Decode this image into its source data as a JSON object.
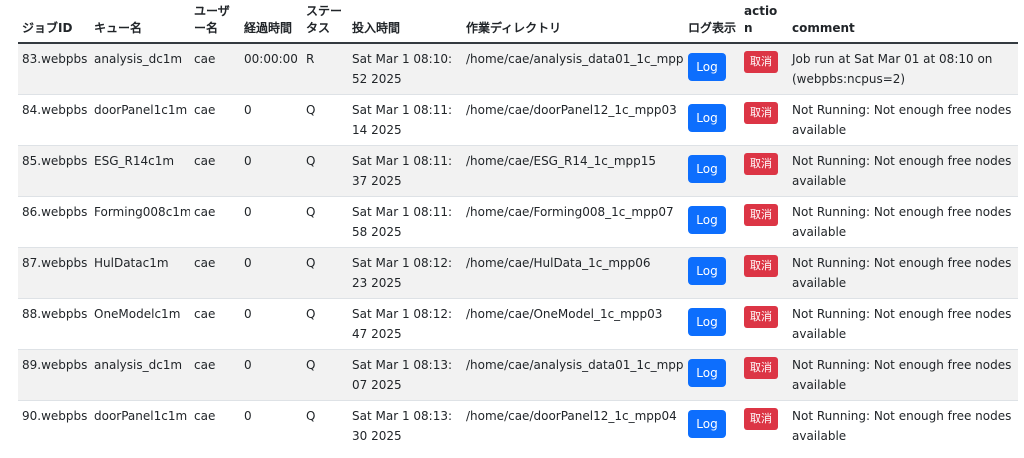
{
  "headers": {
    "job_id": "ジョブID",
    "queue": "キュー名",
    "user": "ユーザー名",
    "elapsed": "経過時間",
    "status": "ステータス",
    "submit_time": "投入時間",
    "work_dir": "作業ディレクトリ",
    "log": "ログ表示",
    "action": "action",
    "comment": "comment"
  },
  "buttons": {
    "log": "Log",
    "cancel": "取消"
  },
  "colors": {
    "log_button": "#0d6efd",
    "cancel_button": "#dc3545",
    "row_stripe": "#f2f2f2"
  },
  "jobs": [
    {
      "id": "83.webpbs",
      "queue": "analysis_dc1m",
      "user": "cae",
      "elapsed": "00:00:00",
      "status": "R",
      "submitted": "Sat Mar 1 08:10:52 2025",
      "dir": "/home/cae/analysis_data01_1c_mpp02",
      "comment": "Job run at Sat Mar 01 at 08:10 on (webpbs:ncpus=2)"
    },
    {
      "id": "84.webpbs",
      "queue": "doorPanel1c1m",
      "user": "cae",
      "elapsed": "0",
      "status": "Q",
      "submitted": "Sat Mar 1 08:11:14 2025",
      "dir": "/home/cae/doorPanel12_1c_mpp03",
      "comment": "Not Running: Not enough free nodes available"
    },
    {
      "id": "85.webpbs",
      "queue": "ESG_R14c1m",
      "user": "cae",
      "elapsed": "0",
      "status": "Q",
      "submitted": "Sat Mar 1 08:11:37 2025",
      "dir": "/home/cae/ESG_R14_1c_mpp15",
      "comment": "Not Running: Not enough free nodes available"
    },
    {
      "id": "86.webpbs",
      "queue": "Forming008c1m",
      "user": "cae",
      "elapsed": "0",
      "status": "Q",
      "submitted": "Sat Mar 1 08:11:58 2025",
      "dir": "/home/cae/Forming008_1c_mpp07",
      "comment": "Not Running: Not enough free nodes available"
    },
    {
      "id": "87.webpbs",
      "queue": "HulDatac1m",
      "user": "cae",
      "elapsed": "0",
      "status": "Q",
      "submitted": "Sat Mar 1 08:12:23 2025",
      "dir": "/home/cae/HulData_1c_mpp06",
      "comment": "Not Running: Not enough free nodes available"
    },
    {
      "id": "88.webpbs",
      "queue": "OneModelc1m",
      "user": "cae",
      "elapsed": "0",
      "status": "Q",
      "submitted": "Sat Mar 1 08:12:47 2025",
      "dir": "/home/cae/OneModel_1c_mpp03",
      "comment": "Not Running: Not enough free nodes available"
    },
    {
      "id": "89.webpbs",
      "queue": "analysis_dc1m",
      "user": "cae",
      "elapsed": "0",
      "status": "Q",
      "submitted": "Sat Mar 1 08:13:07 2025",
      "dir": "/home/cae/analysis_data01_1c_mpp03",
      "comment": "Not Running: Not enough free nodes available"
    },
    {
      "id": "90.webpbs",
      "queue": "doorPanel1c1m",
      "user": "cae",
      "elapsed": "0",
      "status": "Q",
      "submitted": "Sat Mar 1 08:13:30 2025",
      "dir": "/home/cae/doorPanel12_1c_mpp04",
      "comment": "Not Running: Not enough free nodes available"
    }
  ]
}
